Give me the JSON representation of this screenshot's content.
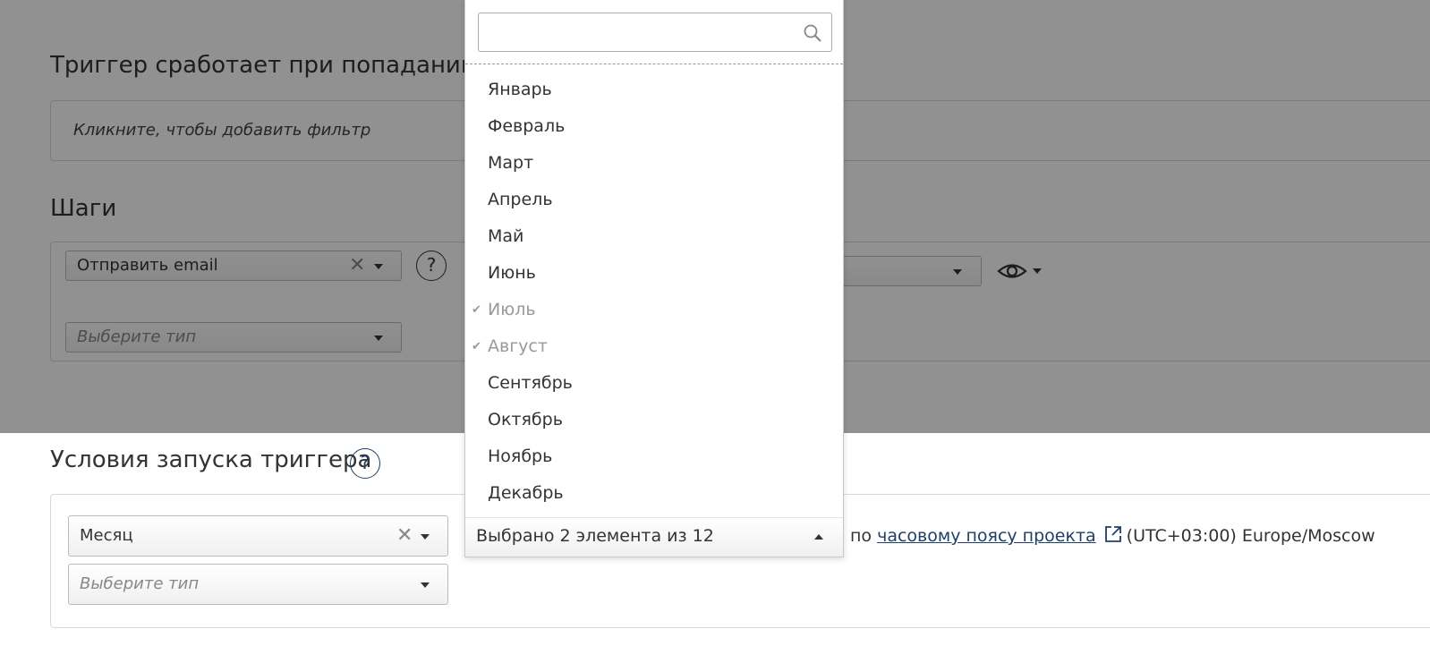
{
  "filter_section": {
    "title": "Триггер сработает при попадании п",
    "placeholder": "Кликните, чтобы добавить фильтр"
  },
  "steps_section": {
    "title": "Шаги",
    "action_select": {
      "value": "Отправить email",
      "clear": "✕"
    },
    "help": "?",
    "type_select": {
      "placeholder": "Выберите тип"
    }
  },
  "conditions_section": {
    "title": "Условия запуска триггера",
    "help": "?",
    "period_select": {
      "value": "Месяц",
      "clear": "✕"
    },
    "type_select": {
      "placeholder": "Выберите тип"
    },
    "timezone": {
      "prefix": "по",
      "link": "часовому поясу проекта",
      "value": "(UTC+03:00) Europe/Moscow"
    }
  },
  "month_dropdown": {
    "search_value": "",
    "items": [
      {
        "label": "Январь",
        "selected": false
      },
      {
        "label": "Февраль",
        "selected": false
      },
      {
        "label": "Март",
        "selected": false
      },
      {
        "label": "Апрель",
        "selected": false
      },
      {
        "label": "Май",
        "selected": false
      },
      {
        "label": "Июнь",
        "selected": false
      },
      {
        "label": "Июль",
        "selected": true
      },
      {
        "label": "Август",
        "selected": true
      },
      {
        "label": "Сентябрь",
        "selected": false
      },
      {
        "label": "Октябрь",
        "selected": false
      },
      {
        "label": "Ноябрь",
        "selected": false
      },
      {
        "label": "Декабрь",
        "selected": false
      }
    ],
    "check_glyph": "✔",
    "summary": "Выбрано 2 элемента из 12"
  },
  "colors": {
    "overlay": "#000000",
    "link": "#1f3f67",
    "selected_item": "#999999"
  }
}
